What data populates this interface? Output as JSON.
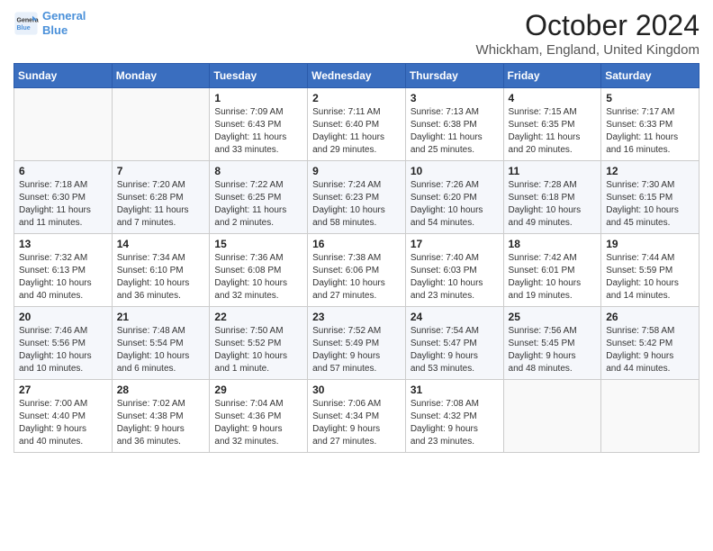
{
  "header": {
    "logo_line1": "General",
    "logo_line2": "Blue",
    "month": "October 2024",
    "location": "Whickham, England, United Kingdom"
  },
  "weekdays": [
    "Sunday",
    "Monday",
    "Tuesday",
    "Wednesday",
    "Thursday",
    "Friday",
    "Saturday"
  ],
  "weeks": [
    [
      {
        "day": "",
        "info": ""
      },
      {
        "day": "",
        "info": ""
      },
      {
        "day": "1",
        "info": "Sunrise: 7:09 AM\nSunset: 6:43 PM\nDaylight: 11 hours\nand 33 minutes."
      },
      {
        "day": "2",
        "info": "Sunrise: 7:11 AM\nSunset: 6:40 PM\nDaylight: 11 hours\nand 29 minutes."
      },
      {
        "day": "3",
        "info": "Sunrise: 7:13 AM\nSunset: 6:38 PM\nDaylight: 11 hours\nand 25 minutes."
      },
      {
        "day": "4",
        "info": "Sunrise: 7:15 AM\nSunset: 6:35 PM\nDaylight: 11 hours\nand 20 minutes."
      },
      {
        "day": "5",
        "info": "Sunrise: 7:17 AM\nSunset: 6:33 PM\nDaylight: 11 hours\nand 16 minutes."
      }
    ],
    [
      {
        "day": "6",
        "info": "Sunrise: 7:18 AM\nSunset: 6:30 PM\nDaylight: 11 hours\nand 11 minutes."
      },
      {
        "day": "7",
        "info": "Sunrise: 7:20 AM\nSunset: 6:28 PM\nDaylight: 11 hours\nand 7 minutes."
      },
      {
        "day": "8",
        "info": "Sunrise: 7:22 AM\nSunset: 6:25 PM\nDaylight: 11 hours\nand 2 minutes."
      },
      {
        "day": "9",
        "info": "Sunrise: 7:24 AM\nSunset: 6:23 PM\nDaylight: 10 hours\nand 58 minutes."
      },
      {
        "day": "10",
        "info": "Sunrise: 7:26 AM\nSunset: 6:20 PM\nDaylight: 10 hours\nand 54 minutes."
      },
      {
        "day": "11",
        "info": "Sunrise: 7:28 AM\nSunset: 6:18 PM\nDaylight: 10 hours\nand 49 minutes."
      },
      {
        "day": "12",
        "info": "Sunrise: 7:30 AM\nSunset: 6:15 PM\nDaylight: 10 hours\nand 45 minutes."
      }
    ],
    [
      {
        "day": "13",
        "info": "Sunrise: 7:32 AM\nSunset: 6:13 PM\nDaylight: 10 hours\nand 40 minutes."
      },
      {
        "day": "14",
        "info": "Sunrise: 7:34 AM\nSunset: 6:10 PM\nDaylight: 10 hours\nand 36 minutes."
      },
      {
        "day": "15",
        "info": "Sunrise: 7:36 AM\nSunset: 6:08 PM\nDaylight: 10 hours\nand 32 minutes."
      },
      {
        "day": "16",
        "info": "Sunrise: 7:38 AM\nSunset: 6:06 PM\nDaylight: 10 hours\nand 27 minutes."
      },
      {
        "day": "17",
        "info": "Sunrise: 7:40 AM\nSunset: 6:03 PM\nDaylight: 10 hours\nand 23 minutes."
      },
      {
        "day": "18",
        "info": "Sunrise: 7:42 AM\nSunset: 6:01 PM\nDaylight: 10 hours\nand 19 minutes."
      },
      {
        "day": "19",
        "info": "Sunrise: 7:44 AM\nSunset: 5:59 PM\nDaylight: 10 hours\nand 14 minutes."
      }
    ],
    [
      {
        "day": "20",
        "info": "Sunrise: 7:46 AM\nSunset: 5:56 PM\nDaylight: 10 hours\nand 10 minutes."
      },
      {
        "day": "21",
        "info": "Sunrise: 7:48 AM\nSunset: 5:54 PM\nDaylight: 10 hours\nand 6 minutes."
      },
      {
        "day": "22",
        "info": "Sunrise: 7:50 AM\nSunset: 5:52 PM\nDaylight: 10 hours\nand 1 minute."
      },
      {
        "day": "23",
        "info": "Sunrise: 7:52 AM\nSunset: 5:49 PM\nDaylight: 9 hours\nand 57 minutes."
      },
      {
        "day": "24",
        "info": "Sunrise: 7:54 AM\nSunset: 5:47 PM\nDaylight: 9 hours\nand 53 minutes."
      },
      {
        "day": "25",
        "info": "Sunrise: 7:56 AM\nSunset: 5:45 PM\nDaylight: 9 hours\nand 48 minutes."
      },
      {
        "day": "26",
        "info": "Sunrise: 7:58 AM\nSunset: 5:42 PM\nDaylight: 9 hours\nand 44 minutes."
      }
    ],
    [
      {
        "day": "27",
        "info": "Sunrise: 7:00 AM\nSunset: 4:40 PM\nDaylight: 9 hours\nand 40 minutes."
      },
      {
        "day": "28",
        "info": "Sunrise: 7:02 AM\nSunset: 4:38 PM\nDaylight: 9 hours\nand 36 minutes."
      },
      {
        "day": "29",
        "info": "Sunrise: 7:04 AM\nSunset: 4:36 PM\nDaylight: 9 hours\nand 32 minutes."
      },
      {
        "day": "30",
        "info": "Sunrise: 7:06 AM\nSunset: 4:34 PM\nDaylight: 9 hours\nand 27 minutes."
      },
      {
        "day": "31",
        "info": "Sunrise: 7:08 AM\nSunset: 4:32 PM\nDaylight: 9 hours\nand 23 minutes."
      },
      {
        "day": "",
        "info": ""
      },
      {
        "day": "",
        "info": ""
      }
    ]
  ]
}
